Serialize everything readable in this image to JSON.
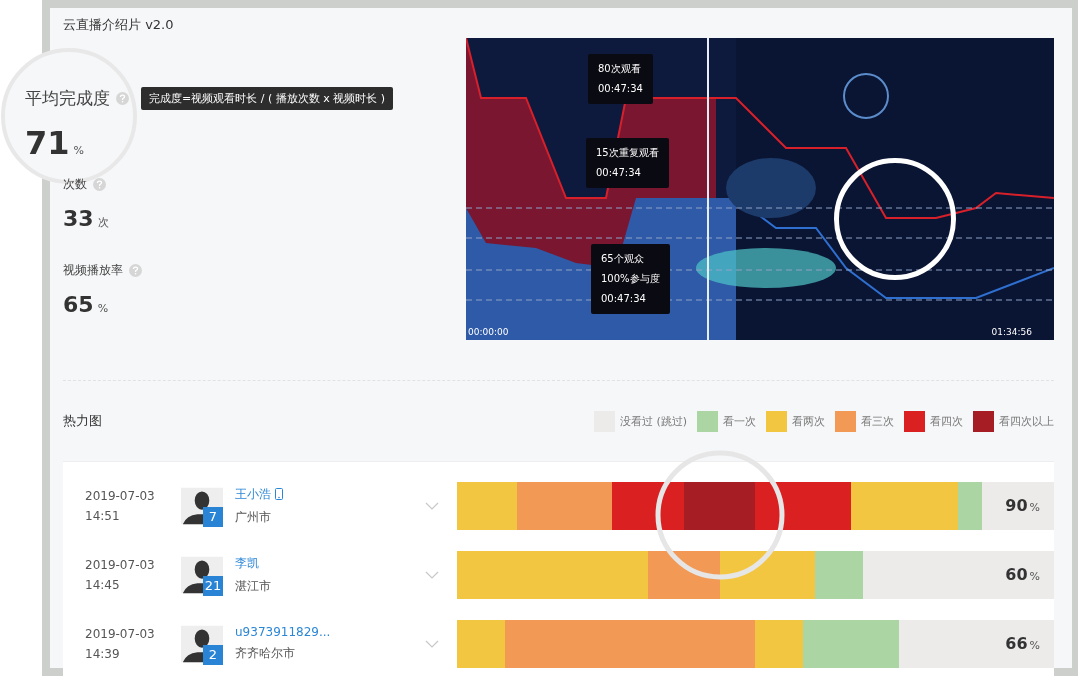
{
  "title": "云直播介绍片 v2.0",
  "stats": [
    {
      "label": "平均完成度",
      "value": "71",
      "unit": "%",
      "tooltip": "完成度=视频观看时长 / ( 播放次数 x 视频时长 )",
      "magnified": true
    },
    {
      "label": "次数",
      "value": "33",
      "unit": "次",
      "magnified": false
    },
    {
      "label": "视频播放率",
      "value": "65",
      "unit": "%",
      "magnified": false
    }
  ],
  "video": {
    "kind": "picture",
    "start_time": "00:00:00",
    "end_time": "01:34:56",
    "callouts": [
      [
        "80次观看",
        "00:47:34"
      ],
      [
        "15次重复观看",
        "00:47:34"
      ],
      [
        "65个观众",
        "100%参与度",
        "00:47:34"
      ]
    ]
  },
  "heatmap": {
    "title": "热力图",
    "legend": [
      {
        "label": "没看过 (跳过)",
        "color": "#ecebea"
      },
      {
        "label": "看一次",
        "color": "#abd5a3"
      },
      {
        "label": "看两次",
        "color": "#f3c642"
      },
      {
        "label": "看三次",
        "color": "#f29a55"
      },
      {
        "label": "看四次",
        "color": "#da2020"
      },
      {
        "label": "看四次以上",
        "color": "#a61d24"
      }
    ],
    "rows": [
      {
        "date": "2019-07-03",
        "time": "14:51",
        "name": "王小浩",
        "mobile": true,
        "badge": "7",
        "city": "广州市",
        "percent": "90",
        "unit": "%",
        "cells": [
          {
            "color": "#f3c642"
          },
          {
            "color": "#f3c642"
          },
          {
            "color": "#f3c642"
          },
          {
            "color": "#f3c642"
          },
          {
            "color": "#f3c642"
          },
          {
            "color": "#f29a55"
          },
          {
            "color": "#f29a55"
          },
          {
            "color": "#f29a55"
          },
          {
            "color": "#f29a55"
          },
          {
            "color": "#f29a55"
          },
          {
            "color": "#f29a55"
          },
          {
            "color": "#f29a55"
          },
          {
            "color": "#f29a55"
          },
          {
            "color": "#da2020"
          },
          {
            "color": "#da2020"
          },
          {
            "color": "#da2020"
          },
          {
            "color": "#da2020"
          },
          {
            "color": "#da2020"
          },
          {
            "color": "#da2020"
          },
          {
            "color": "#a61d24"
          },
          {
            "color": "#a61d24"
          },
          {
            "color": "#a61d24"
          },
          {
            "color": "#a61d24"
          },
          {
            "color": "#a61d24"
          },
          {
            "color": "#a61d24"
          },
          {
            "color": "#da2020"
          },
          {
            "color": "#da2020"
          },
          {
            "color": "#da2020"
          },
          {
            "color": "#da2020"
          },
          {
            "color": "#da2020"
          },
          {
            "color": "#da2020"
          },
          {
            "color": "#da2020"
          },
          {
            "color": "#da2020"
          },
          {
            "color": "#f3c642"
          },
          {
            "color": "#f3c642"
          },
          {
            "color": "#f3c642"
          },
          {
            "color": "#f3c642"
          },
          {
            "color": "#f3c642"
          },
          {
            "color": "#f3c642"
          },
          {
            "color": "#f3c642"
          },
          {
            "color": "#f3c642"
          },
          {
            "color": "#f3c642"
          },
          {
            "color": "#abd5a3"
          },
          {
            "color": "#abd5a3"
          }
        ]
      },
      {
        "date": "2019-07-03",
        "time": "14:45",
        "name": "李凯",
        "mobile": false,
        "badge": "21",
        "city": "湛江市",
        "percent": "60",
        "unit": "%",
        "cells": [
          {
            "color": "#f3c642"
          },
          {
            "color": "#f3c642"
          },
          {
            "color": "#f3c642"
          },
          {
            "color": "#f3c642"
          },
          {
            "color": "#f3c642"
          },
          {
            "color": "#f3c642"
          },
          {
            "color": "#f3c642"
          },
          {
            "color": "#f3c642"
          },
          {
            "color": "#f3c642"
          },
          {
            "color": "#f3c642"
          },
          {
            "color": "#f3c642"
          },
          {
            "color": "#f3c642"
          },
          {
            "color": "#f3c642"
          },
          {
            "color": "#f3c642"
          },
          {
            "color": "#f3c642"
          },
          {
            "color": "#f3c642"
          },
          {
            "color": "#f29a55"
          },
          {
            "color": "#f29a55"
          },
          {
            "color": "#f29a55"
          },
          {
            "color": "#f29a55"
          },
          {
            "color": "#f29a55"
          },
          {
            "color": "#f29a55"
          },
          {
            "color": "#f3c642"
          },
          {
            "color": "#f3c642"
          },
          {
            "color": "#f3c642"
          },
          {
            "color": "#f3c642"
          },
          {
            "color": "#f3c642"
          },
          {
            "color": "#f3c642"
          },
          {
            "color": "#f3c642"
          },
          {
            "color": "#f3c642"
          },
          {
            "color": "#abd5a3"
          },
          {
            "color": "#abd5a3"
          },
          {
            "color": "#abd5a3"
          },
          {
            "color": "#abd5a3"
          }
        ]
      },
      {
        "date": "2019-07-03",
        "time": "14:39",
        "name": "u9373911829...",
        "mobile": false,
        "badge": "2",
        "city": "齐齐哈尔市",
        "percent": "66",
        "unit": "%",
        "cells": [
          {
            "color": "#f3c642"
          },
          {
            "color": "#f3c642"
          },
          {
            "color": "#f3c642"
          },
          {
            "color": "#f3c642"
          },
          {
            "color": "#f29a55"
          },
          {
            "color": "#f29a55"
          },
          {
            "color": "#f29a55"
          },
          {
            "color": "#f29a55"
          },
          {
            "color": "#f29a55"
          },
          {
            "color": "#f29a55"
          },
          {
            "color": "#f29a55"
          },
          {
            "color": "#f29a55"
          },
          {
            "color": "#f29a55"
          },
          {
            "color": "#f29a55"
          },
          {
            "color": "#f29a55"
          },
          {
            "color": "#f29a55"
          },
          {
            "color": "#f29a55"
          },
          {
            "color": "#f29a55"
          },
          {
            "color": "#f29a55"
          },
          {
            "color": "#f29a55"
          },
          {
            "color": "#f29a55"
          },
          {
            "color": "#f29a55"
          },
          {
            "color": "#f29a55"
          },
          {
            "color": "#f29a55"
          },
          {
            "color": "#f29a55"
          },
          {
            "color": "#f3c642"
          },
          {
            "color": "#f3c642"
          },
          {
            "color": "#f3c642"
          },
          {
            "color": "#f3c642"
          },
          {
            "color": "#abd5a3"
          },
          {
            "color": "#abd5a3"
          },
          {
            "color": "#abd5a3"
          },
          {
            "color": "#abd5a3"
          },
          {
            "color": "#abd5a3"
          },
          {
            "color": "#abd5a3"
          },
          {
            "color": "#abd5a3"
          },
          {
            "color": "#abd5a3"
          }
        ]
      }
    ]
  }
}
